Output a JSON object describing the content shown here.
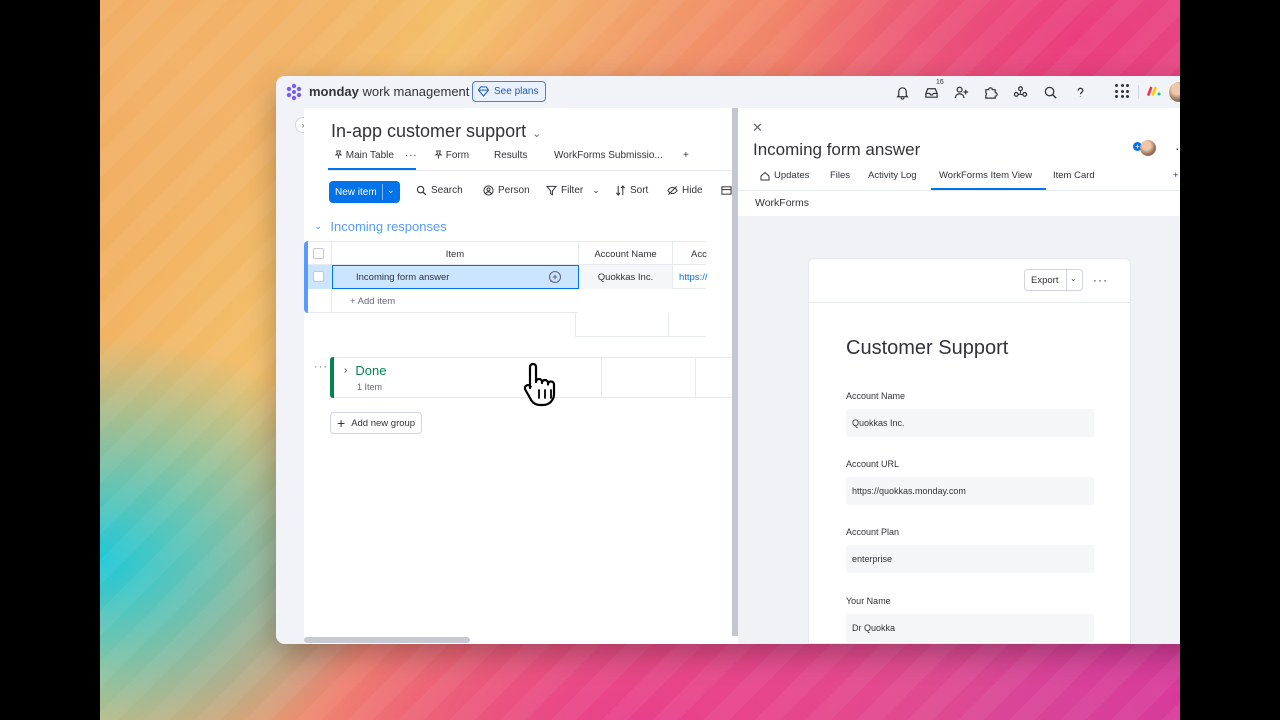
{
  "app": {
    "brand_bold": "monday",
    "brand_rest": " work management",
    "see_plans": "See plans",
    "notifications_count": "16"
  },
  "board": {
    "title": "In-app customer support",
    "views": [
      "Main Table",
      "Form",
      "Results",
      "WorkForms Submissio...",
      "+"
    ],
    "toolbar": {
      "new_item": "New item",
      "search": "Search",
      "person": "Person",
      "filter": "Filter",
      "sort": "Sort",
      "hide": "Hide"
    },
    "groups": {
      "incoming": {
        "title": "Incoming responses",
        "columns": [
          "Item",
          "Account Name",
          "Acc"
        ],
        "rows": [
          {
            "item": "Incoming form answer",
            "account_name": "Quokkas Inc.",
            "account_url": "https://"
          }
        ],
        "add_item": "+ Add item"
      },
      "done": {
        "title": "Done",
        "count": "1 Item"
      }
    },
    "add_group": "Add new group"
  },
  "panel": {
    "title": "Incoming form answer",
    "tabs": [
      "Updates",
      "Files",
      "Activity Log",
      "WorkForms Item View",
      "Item Card",
      "+"
    ],
    "section_label": "WorkForms",
    "export": "Export",
    "form": {
      "title": "Customer Support",
      "fields": [
        {
          "label": "Account Name",
          "value": "Quokkas Inc."
        },
        {
          "label": "Account URL",
          "value": "https://quokkas.monday.com"
        },
        {
          "label": "Account Plan",
          "value": "enterprise"
        },
        {
          "label": "Your Name",
          "value": "Dr Quokka"
        }
      ]
    }
  },
  "colors": {
    "primary": "#0073ea",
    "group_incoming": "#579bfc",
    "group_done": "#00854d",
    "selected_row": "#cce5ff"
  }
}
